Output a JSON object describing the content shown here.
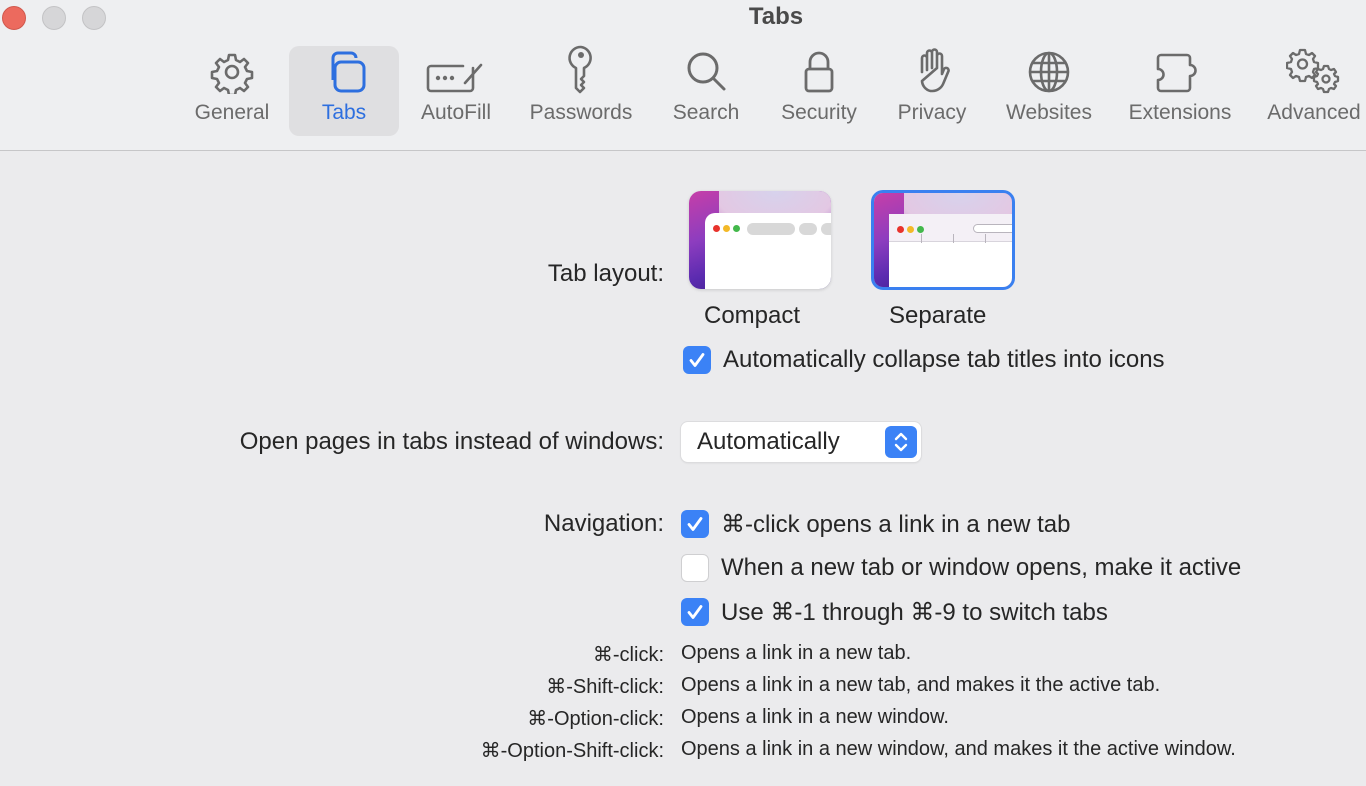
{
  "window": {
    "title": "Tabs"
  },
  "toolbar": {
    "items": [
      {
        "label": "General",
        "icon": "gear-icon"
      },
      {
        "label": "Tabs",
        "icon": "tabs-icon",
        "active": true
      },
      {
        "label": "AutoFill",
        "icon": "autofill-icon"
      },
      {
        "label": "Passwords",
        "icon": "key-icon"
      },
      {
        "label": "Search",
        "icon": "search-icon"
      },
      {
        "label": "Security",
        "icon": "lock-icon"
      },
      {
        "label": "Privacy",
        "icon": "hand-icon"
      },
      {
        "label": "Websites",
        "icon": "globe-icon"
      },
      {
        "label": "Extensions",
        "icon": "puzzle-icon"
      },
      {
        "label": "Advanced",
        "icon": "gears-icon"
      }
    ]
  },
  "tab_layout": {
    "label": "Tab layout:",
    "options": [
      {
        "label": "Compact",
        "selected": false
      },
      {
        "label": "Separate",
        "selected": true
      }
    ],
    "collapse_checkbox": {
      "label": "Automatically collapse tab titles into icons",
      "checked": true
    }
  },
  "open_pages": {
    "label": "Open pages in tabs instead of windows:",
    "value": "Automatically"
  },
  "navigation": {
    "label": "Navigation:",
    "options": [
      {
        "label": "⌘-click opens a link in a new tab",
        "checked": true
      },
      {
        "label": "When a new tab or window opens, make it active",
        "checked": false
      },
      {
        "label": "Use ⌘-1 through ⌘-9 to switch tabs",
        "checked": true
      }
    ]
  },
  "shortcuts": [
    {
      "key": "⌘-click:",
      "desc": "Opens a link in a new tab."
    },
    {
      "key": "⌘-Shift-click:",
      "desc": "Opens a link in a new tab, and makes it the active tab."
    },
    {
      "key": "⌘-Option-click:",
      "desc": "Opens a link in a new window."
    },
    {
      "key": "⌘-Option-Shift-click:",
      "desc": "Opens a link in a new window, and makes it the active window."
    }
  ],
  "colors": {
    "accent": "#3b82f6",
    "active_tab_label": "#2d6fdf",
    "close": "#ec6a5e"
  }
}
